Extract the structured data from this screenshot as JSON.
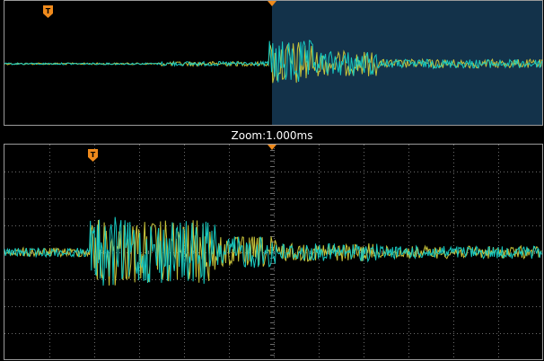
{
  "zoom_label": "Zoom:1.000ms",
  "trigger_marker_glyph": "T",
  "colors": {
    "background": "#000000",
    "window_fill": "#13324a",
    "frame": "#9a9a9a",
    "grid": "#6c6c6c",
    "trace_cyan": "#17c9c0",
    "trace_yellow": "#c9c43a",
    "marker_orange": "#ef8a1c",
    "label_text": "#ffffff"
  },
  "icons": {
    "trigger_marker": "trigger-position-icon",
    "trigger_time": "trigger-time-arrow-icon"
  }
}
